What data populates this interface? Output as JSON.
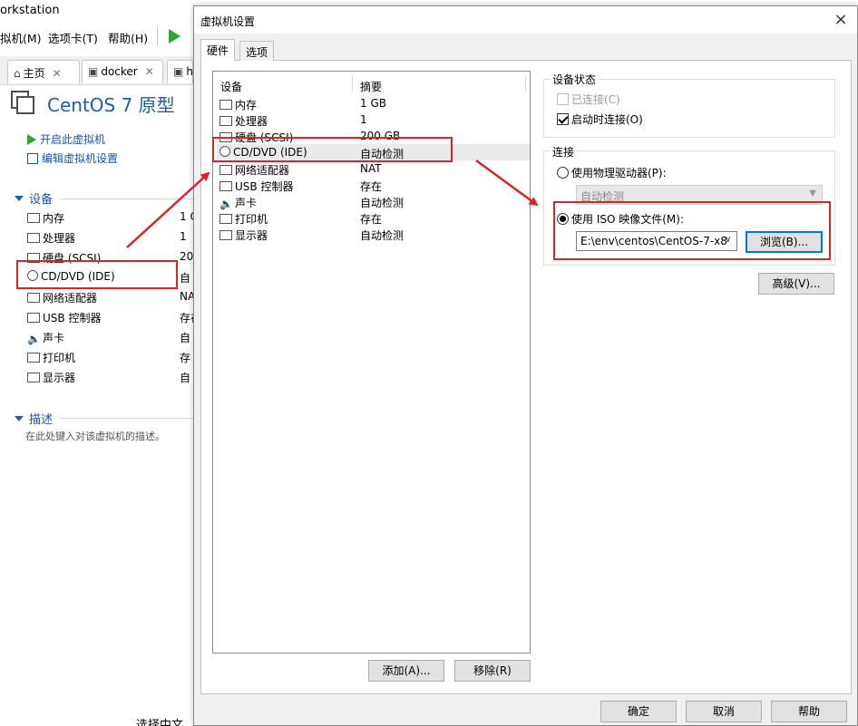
{
  "bg": {
    "title": "orkstation",
    "menu": [
      "拟机(M)",
      "选项卡(T)",
      "帮助(H)"
    ],
    "tabs": [
      {
        "label": "主页",
        "icon": "home-icon"
      },
      {
        "label": "docker",
        "icon": "vm-icon"
      },
      {
        "label": "h",
        "icon": "vm-icon"
      }
    ],
    "vm_title": "CentOS 7 原型",
    "actions": [
      "开启此虚拟机",
      "编辑虚拟机设置"
    ],
    "devices_header": "设备",
    "devices": [
      {
        "name": "内存",
        "value": "1 C"
      },
      {
        "name": "处理器",
        "value": "1"
      },
      {
        "name": "硬盘 (SCSI)",
        "value": "20"
      },
      {
        "name": "CD/DVD (IDE)",
        "value": "自"
      },
      {
        "name": "网络适配器",
        "value": "NA"
      },
      {
        "name": "USB 控制器",
        "value": "存在"
      },
      {
        "name": "声卡",
        "value": "自"
      },
      {
        "name": "打印机",
        "value": "存"
      },
      {
        "name": "显示器",
        "value": "自"
      }
    ],
    "desc_header": "描述",
    "desc_text": "在此处键入对该虚拟机的描述。",
    "bottom_text": "选择中文"
  },
  "dialog": {
    "title": "虚拟机设置",
    "close": "×",
    "tabs": [
      "硬件",
      "选项"
    ],
    "columns": {
      "device": "设备",
      "summary": "摘要"
    },
    "devices": [
      {
        "name": "内存",
        "summary": "1 GB",
        "icon": "memory-icon"
      },
      {
        "name": "处理器",
        "summary": "1",
        "icon": "cpu-icon"
      },
      {
        "name": "硬盘 (SCSI)",
        "summary": "200 GB",
        "icon": "disk-icon"
      },
      {
        "name": "CD/DVD (IDE)",
        "summary": "自动检测",
        "icon": "cd-icon"
      },
      {
        "name": "网络适配器",
        "summary": "NAT",
        "icon": "network-icon"
      },
      {
        "name": "USB 控制器",
        "summary": "存在",
        "icon": "usb-icon"
      },
      {
        "name": "声卡",
        "summary": "自动检测",
        "icon": "speaker-icon"
      },
      {
        "name": "打印机",
        "summary": "存在",
        "icon": "printer-icon"
      },
      {
        "name": "显示器",
        "summary": "自动检测",
        "icon": "monitor-icon"
      }
    ],
    "selected_device": "CD/DVD (IDE)",
    "add_button": "添加(A)...",
    "remove_button": "移除(R)",
    "device_status": {
      "label": "设备状态",
      "connected": "已连接(C)",
      "connect_on_start": "启动时连接(O)"
    },
    "connection": {
      "label": "连接",
      "use_physical": "使用物理驱动器(P):",
      "physical_value": "自动检测",
      "use_iso": "使用 ISO 映像文件(M):",
      "iso_path": "E:\\env\\centos\\CentOS-7-x8",
      "browse": "浏览(B)..."
    },
    "advanced": "高级(V)...",
    "ok": "确定",
    "cancel": "取消",
    "help": "帮助"
  },
  "colors": {
    "highlight": "#d9252a",
    "accent": "#1a56a6",
    "play": "#2fa532"
  }
}
